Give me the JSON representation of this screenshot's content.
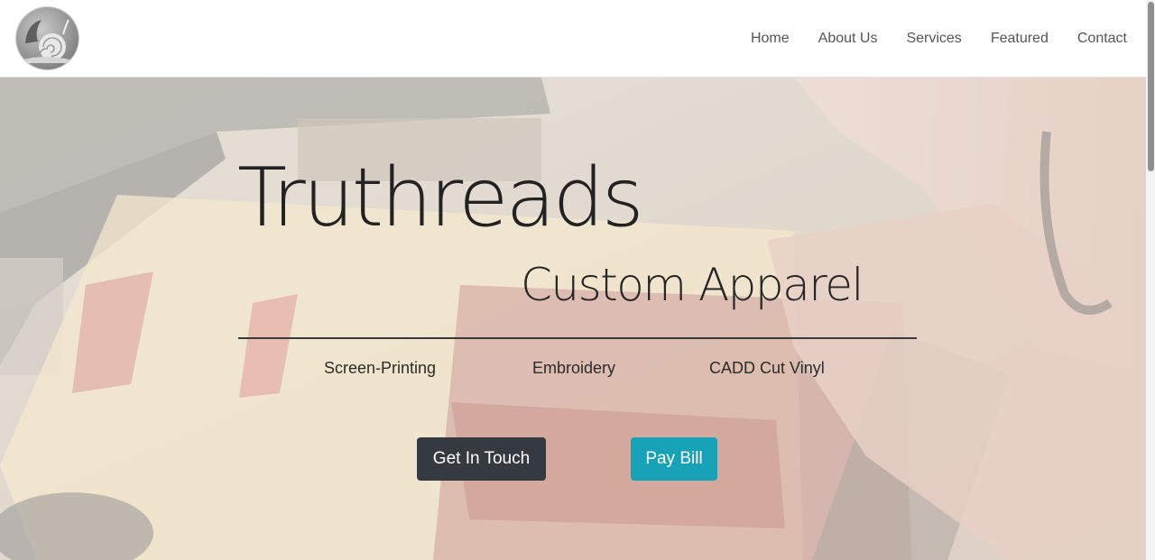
{
  "nav": {
    "logo_icon": "snail-logo-icon",
    "links": [
      {
        "label": "Home"
      },
      {
        "label": "About Us"
      },
      {
        "label": "Services"
      },
      {
        "label": "Featured"
      },
      {
        "label": "Contact"
      }
    ]
  },
  "hero": {
    "title": "Truthreads",
    "subtitle": "Custom Apparel",
    "services": [
      "Screen-Printing",
      "Embroidery",
      "CADD Cut Vinyl"
    ],
    "buttons": {
      "get_in_touch": "Get In Touch",
      "pay_bill": "Pay Bill"
    },
    "background_image": "screen-printing-press-photo"
  },
  "colors": {
    "dark_button": "#343a40",
    "info_button": "#17a2b8",
    "nav_text": "#555555"
  }
}
